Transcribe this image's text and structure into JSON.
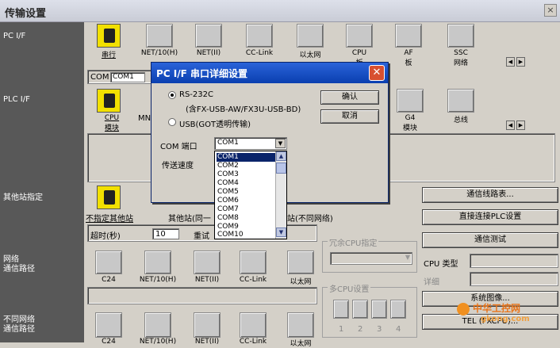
{
  "window": {
    "title": "传输设置",
    "close_symbol": "×"
  },
  "left_labels": {
    "pc_if": "PC I/F",
    "plc_if": "PLC I/F",
    "other_station": "其他站指定",
    "network_route_1": "网络",
    "network_route_2": "通信路径",
    "diff_network_1": "不同网络",
    "diff_network_2": "通信路径"
  },
  "pc_if": {
    "items": [
      "串行",
      "NET/10(H)",
      "NET(II)",
      "CC-Link",
      "以太网",
      "CPU",
      "AF",
      "SSC"
    ],
    "sub_labels": {
      "cpu": "板",
      "af": "板",
      "ssc": "网络"
    },
    "com_label": "COM",
    "com_value": "COM1"
  },
  "plc_if": {
    "items": [
      "CPU",
      "MNE",
      "G4",
      "总线"
    ],
    "sub_labels": {
      "cpu": "模块",
      "g4": "模块"
    }
  },
  "other_station": {
    "no_spec": "不指定其他站",
    "same_net": "其他站(同一",
    "diff_net": "站(不同网络)",
    "timeout_label": "超时(秒)",
    "timeout_value": "10",
    "retry_label": "重试"
  },
  "network_route": {
    "items": [
      "C24",
      "NET/10(H)",
      "NET(II)",
      "CC-Link",
      "以太网"
    ]
  },
  "diff_network_route": {
    "items": [
      "C24",
      "NET/10(H)",
      "NET(II)",
      "CC-Link",
      "以太网"
    ]
  },
  "redundant_cpu": {
    "label": "冗余CPU指定"
  },
  "multi_cpu": {
    "label": "多CPU设置",
    "numbers": [
      "1",
      "2",
      "3",
      "4"
    ]
  },
  "right_buttons": {
    "route_table": "通信线路表...",
    "direct_plc": "直接连接PLC设置",
    "comm_test": "通信测试",
    "cpu_type": "CPU 类型",
    "detail": "详细",
    "system_image": "系统图像...",
    "tel": "TEL (FXCPU)..."
  },
  "dialog": {
    "title": "PC I/F 串口详细设置",
    "rs232c": "RS-232C",
    "rs232c_note": "(含FX-USB-AW/FX3U-USB-BD)",
    "usb": "USB(GOT透明传输)",
    "ok": "确认",
    "cancel": "取消",
    "com_port_label": "COM 端口",
    "com_port_value": "COM1",
    "baud_label": "传送速度",
    "com_options": [
      "COM1",
      "COM2",
      "COM3",
      "COM4",
      "COM5",
      "COM6",
      "COM7",
      "COM8",
      "COM9",
      "COM10"
    ]
  },
  "watermark": {
    "text1": "中华工控网",
    "text2": "gkong.com"
  }
}
